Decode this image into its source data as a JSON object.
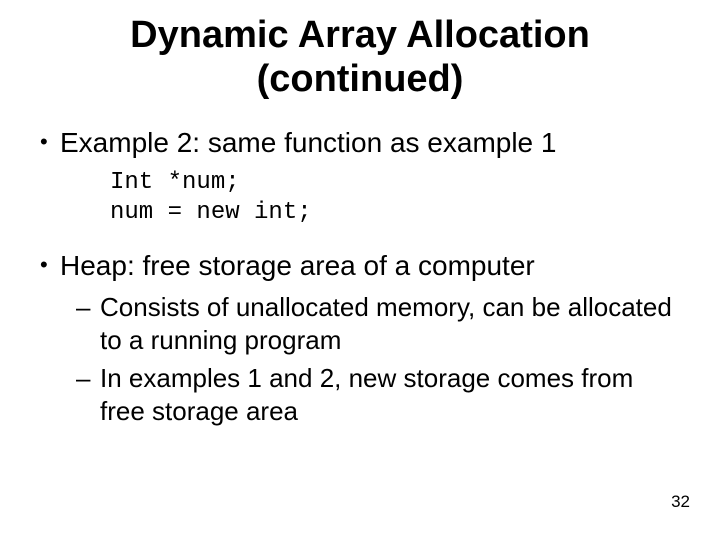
{
  "title_line1": "Dynamic Array Allocation",
  "title_line2": "(continued)",
  "bullet1": "Example 2: same function as example 1",
  "code_line1": "Int *num;",
  "code_line2": "num = new int;",
  "bullet2": "Heap: free storage area of a computer",
  "sub1": "Consists of unallocated memory, can be allocated to a running program",
  "sub2": "In examples 1 and 2, new storage comes from free storage area",
  "page_number": "32",
  "glyphs": {
    "bullet": "•",
    "dash": "–"
  }
}
